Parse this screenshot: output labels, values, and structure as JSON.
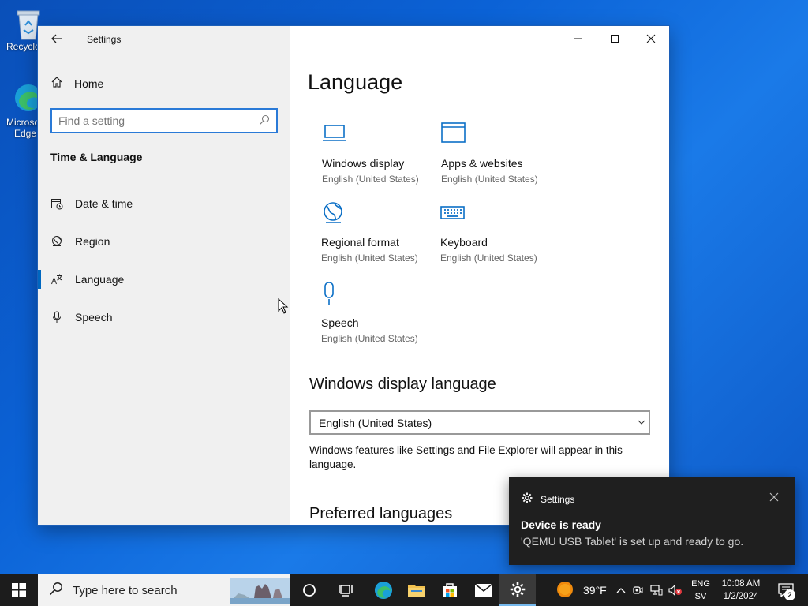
{
  "desktop": {
    "icons": [
      {
        "label": "Recycle Bin"
      },
      {
        "label": "Microsoft Edge"
      }
    ]
  },
  "window": {
    "title": "Settings",
    "sidebar": {
      "home_label": "Home",
      "search_placeholder": "Find a setting",
      "section_title": "Time & Language",
      "items": [
        {
          "label": "Date & time",
          "icon": "calendar-clock-icon"
        },
        {
          "label": "Region",
          "icon": "globe-icon"
        },
        {
          "label": "Language",
          "icon": "language-icon",
          "active": true
        },
        {
          "label": "Speech",
          "icon": "microphone-icon"
        }
      ]
    },
    "content": {
      "title": "Language",
      "tiles": [
        {
          "name": "Windows display",
          "sub": "English (United States)",
          "icon": "laptop-icon"
        },
        {
          "name": "Apps & websites",
          "sub": "English (United States)",
          "icon": "window-icon"
        },
        {
          "name": "Regional format",
          "sub": "English (United States)",
          "icon": "globe-icon"
        },
        {
          "name": "Keyboard",
          "sub": "English (United States)",
          "icon": "keyboard-icon"
        },
        {
          "name": "Speech",
          "sub": "English (United States)",
          "icon": "microphone-icon"
        }
      ],
      "display_language_heading": "Windows display language",
      "display_language_value": "English (United States)",
      "display_language_desc": "Windows features like Settings and File Explorer will appear in this language.",
      "preferred_heading": "Preferred languages"
    }
  },
  "toast": {
    "app": "Settings",
    "title": "Device is ready",
    "message": "'QEMU USB Tablet' is set up and ready to go."
  },
  "taskbar": {
    "search_placeholder": "Type here to search",
    "weather_temp": "39°F",
    "lang_line1": "ENG",
    "lang_line2": "SV",
    "time": "10:08 AM",
    "date": "1/2/2024",
    "notification_count": "2"
  },
  "colors": {
    "accent": "#0067c0",
    "icon_blue": "#0b6fc6",
    "taskbar": "#1c1c1c",
    "toast": "#1f1f1f"
  }
}
